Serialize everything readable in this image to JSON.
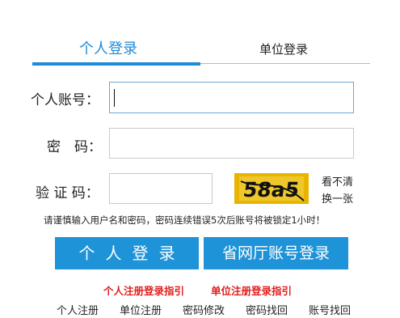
{
  "tabs": {
    "personal": "个人登录",
    "unit": "单位登录"
  },
  "form": {
    "account_label": "个人账号：",
    "password_label": "密　码：",
    "captcha_label": "验 证 码：",
    "account_value": "",
    "password_value": "",
    "captcha_value": "",
    "captcha_image_text": "58a5",
    "refresh_line1": "看不清",
    "refresh_line2": "换一张"
  },
  "hint": "请谨慎输入用户名和密码，密码连续错误5次后账号将被锁定1小时！",
  "buttons": {
    "login": "个人登录",
    "province_login": "省网厅账号登录"
  },
  "guides": {
    "personal": "个人注册登录指引",
    "unit": "单位注册登录指引"
  },
  "bottom_links": {
    "register": "个人注册",
    "unit_register": "单位注册",
    "change_password": "密码修改",
    "find_password": "密码找回",
    "find_account": "账号找回"
  },
  "colors": {
    "accent": "#1f93d8",
    "link_red": "#e02020",
    "captcha_bg": "#e8b400"
  }
}
